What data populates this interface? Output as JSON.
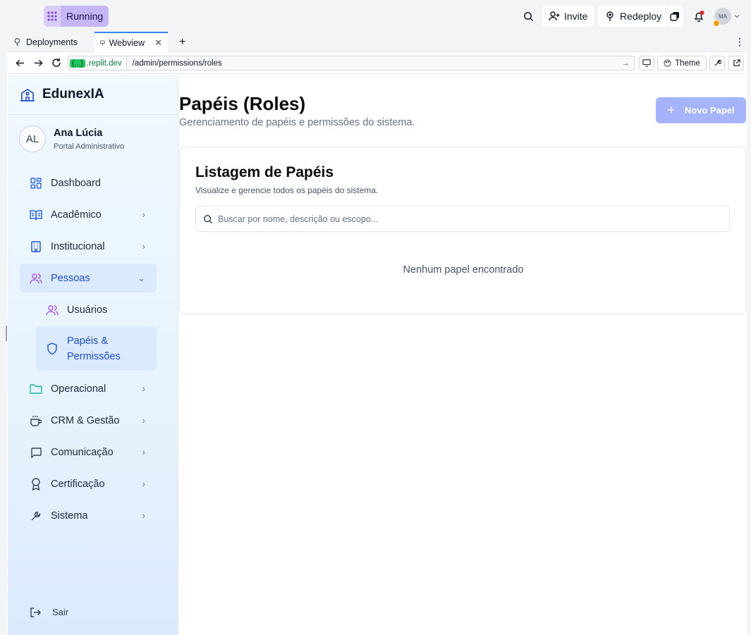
{
  "topbar": {
    "status_label": "Running",
    "invite_label": "Invite",
    "redeploy_label": "Redeploy",
    "avatar_initials": "MA"
  },
  "tabs": [
    {
      "label": "Deployments"
    },
    {
      "label": "Webview"
    }
  ],
  "address": {
    "host_badge": "{...}",
    "host": ".replit.dev",
    "path": "/admin/permissions/roles",
    "theme_label": "Theme"
  },
  "sidebar": {
    "brand": "EdunexIA",
    "user": {
      "initials": "AL",
      "name": "Ana Lúcia",
      "role": "Portal Administrativo"
    },
    "items": [
      {
        "label": "Dashboard"
      },
      {
        "label": "Acadêmico"
      },
      {
        "label": "Institucional"
      },
      {
        "label": "Pessoas"
      },
      {
        "label": "Operacional"
      },
      {
        "label": "CRM & Gestão"
      },
      {
        "label": "Comunicação"
      },
      {
        "label": "Certificação"
      },
      {
        "label": "Sistema"
      }
    ],
    "subitems": [
      {
        "label": "Usuários"
      },
      {
        "label_line1": "Papéis &",
        "label_line2": "Permissões"
      }
    ],
    "logout_label": "Sair"
  },
  "main": {
    "title": "Papéis (Roles)",
    "subtitle": "Gerenciamento de papéis e permissões do sistema.",
    "new_button_label": "Novo Papel",
    "card": {
      "title": "Listagem de Papéis",
      "subtitle": "Visualize e gerencie todos os papéis do sistema.",
      "search_placeholder": "Buscar por nome, descrição ou escopo...",
      "empty_message": "Nenhum papel encontrado"
    }
  },
  "colors": {
    "accent": "#1d4ed8",
    "new_button_bg": "#a5b4fc",
    "running_pill": "#c7b6f7",
    "notification_dot": "#dc2626"
  }
}
